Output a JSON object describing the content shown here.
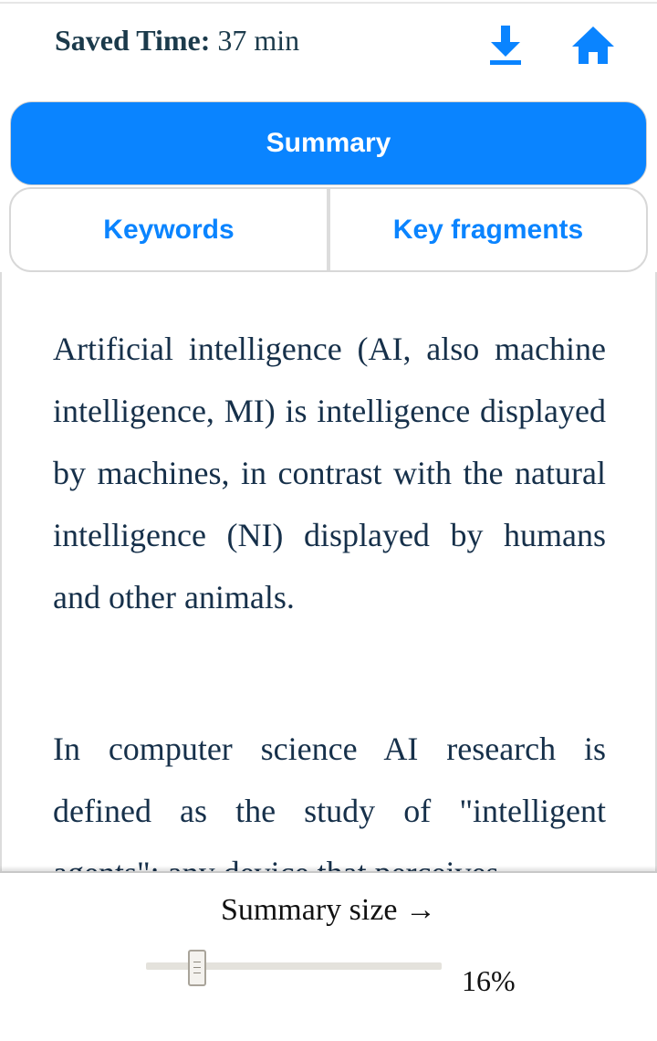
{
  "header": {
    "saved_time_label": "Saved Time:",
    "saved_time_value": "37 min",
    "download_icon": "download-icon",
    "home_icon": "home-icon",
    "accent_color": "#0a84ff"
  },
  "tabs": {
    "summary": "Summary",
    "keywords": "Keywords",
    "key_fragments": "Key fragments",
    "active": "Summary"
  },
  "content": {
    "paragraphs": [
      "Artificial intelligence (AI, also machine intelligence, MI) is intelligence displayed by machines, in contrast with the natural intelligence (NI) displayed by humans and other animals.",
      "In computer science AI research is defined as the study of \"intelligent agents\": any device that perceives"
    ]
  },
  "footer": {
    "summary_size_label": "Summary size →",
    "slider_value": 16,
    "slider_percent_text": "16%"
  }
}
